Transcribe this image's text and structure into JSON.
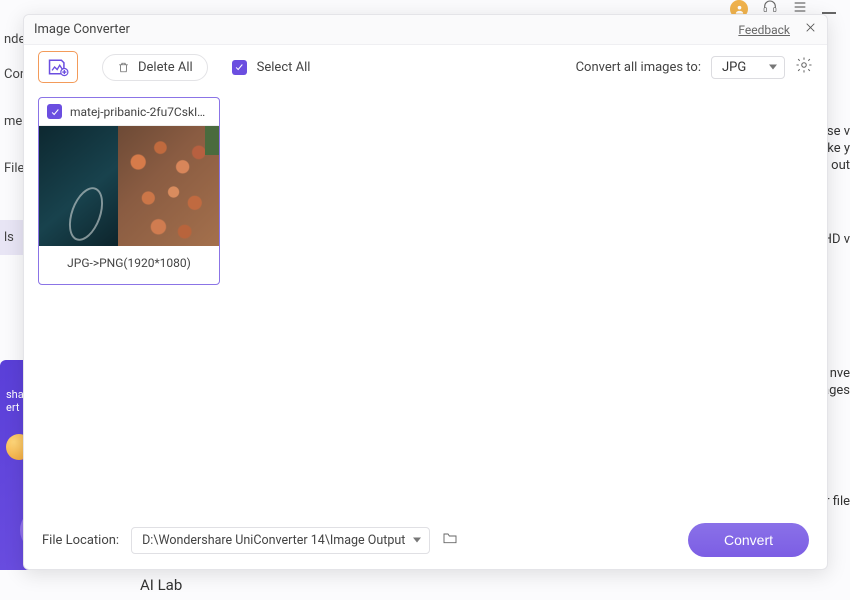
{
  "background": {
    "sidebar": {
      "items": [
        "nde",
        "Con",
        "me",
        "File",
        "ls"
      ]
    },
    "promo": {
      "line1": "sha",
      "line2": "ert"
    },
    "ai_lab": "AI Lab",
    "right_snips": {
      "a": "use v",
      "b": "ake y",
      "c": "d out",
      "d": "HD v",
      "e": "nve",
      "f": "ages",
      "g": "ur file"
    }
  },
  "modal": {
    "title": "Image Converter",
    "feedback": "Feedback",
    "toolbar": {
      "delete_all": "Delete All",
      "select_all": "Select All",
      "convert_to_label": "Convert all images to:",
      "format_selected": "JPG"
    },
    "items": [
      {
        "filename": "matej-pribanic-2fu7CskIT...",
        "conversion": "JPG->PNG(1920*1080)"
      }
    ],
    "footer": {
      "file_location_label": "File Location:",
      "file_location_path": "D:\\Wondershare UniConverter 14\\Image Output",
      "convert_label": "Convert"
    }
  }
}
